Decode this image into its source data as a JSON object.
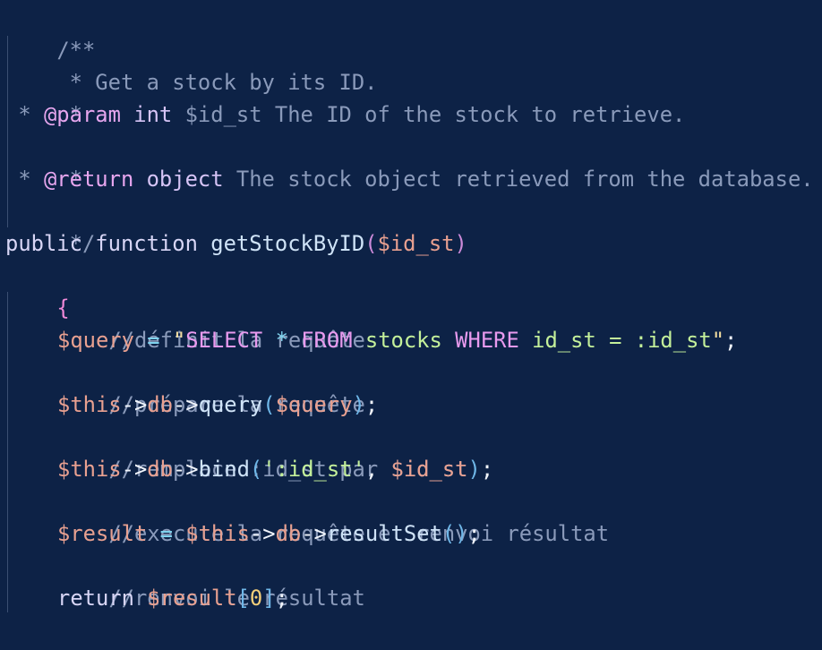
{
  "code": {
    "language": "php",
    "doc": {
      "open": "/**",
      "summary": " * Get a stock by its ID.",
      "blank1": " *",
      "param_star": " * ",
      "param_tag": "@param",
      "param_type": "int",
      "param_var": "$id_st",
      "param_desc": " The ID of the stock to retrieve.",
      "blank2": " *",
      "return_star": " * ",
      "return_tag": "@return",
      "return_type": "object",
      "return_desc": " The stock object retrieved from the database.",
      "close": " */"
    },
    "signature": {
      "public": "public",
      "function": "function",
      "name": "getStockByID",
      "open_paren": "(",
      "param": "$id_st",
      "close_paren": ")"
    },
    "open_brace": "{",
    "close_brace": "}",
    "comment1": "//définit la requête",
    "line_query": {
      "var": "$query",
      "eq": " = ",
      "q_open": "\"",
      "sql_select": "SELECT",
      "sql_star": " * ",
      "sql_from": "FROM",
      "sql_table": " stocks ",
      "sql_where": "WHERE",
      "sql_cond": " id_st = :id_st",
      "q_close": "\"",
      "semi": ";"
    },
    "comment2": "//prépare la requête",
    "line_prepare": {
      "this": "$this",
      "arrow1": "->",
      "db": "db",
      "arrow2": "->",
      "method": "query",
      "open": "(",
      "arg": "$query",
      "close": ")",
      "semi": ";"
    },
    "comment3": "//remplace :id_st par $id_st",
    "line_bind": {
      "this": "$this",
      "arrow1": "->",
      "db": "db",
      "arrow2": "->",
      "method": "bind",
      "open": "(",
      "arg1": "':id_st'",
      "comma": ", ",
      "arg2": "$id_st",
      "close": ")",
      "semi": ";"
    },
    "comment4": "//execute la requête et renvoi résultat",
    "line_result": {
      "var": "$result",
      "eq": " = ",
      "this": "$this",
      "arrow1": "->",
      "db": "db",
      "arrow2": "->",
      "method": "resultSet",
      "parens": "()",
      "semi": ";"
    },
    "comment5": "//renvoi le résultat",
    "line_return": {
      "keyword": "return",
      "var": " $result",
      "open": "[",
      "index": "0",
      "close": "]",
      "semi": ";"
    }
  }
}
